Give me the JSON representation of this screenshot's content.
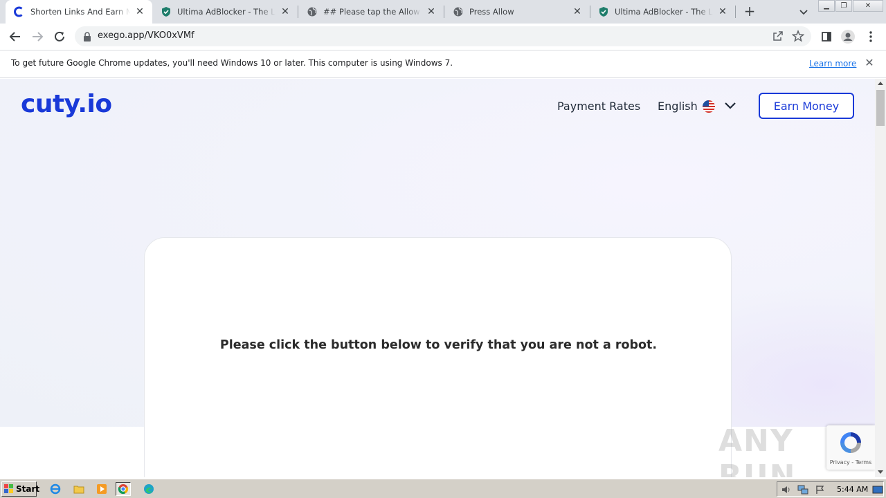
{
  "browser": {
    "tabs": [
      {
        "title": "Shorten Links And Earn Money",
        "favicon": "cuty-icon",
        "active": true
      },
      {
        "title": "Ultima AdBlocker - The Life with",
        "favicon": "shield-icon",
        "active": false
      },
      {
        "title": "## Please tap the Allow button",
        "favicon": "globe-icon",
        "active": false
      },
      {
        "title": "Press Allow",
        "favicon": "globe-icon",
        "active": false
      },
      {
        "title": "Ultima AdBlocker - The Life with",
        "favicon": "shield-icon",
        "active": false
      }
    ],
    "url": "exego.app/VKO0xVMf"
  },
  "infobar": {
    "message": "To get future Google Chrome updates, you'll need Windows 10 or later. This computer is using Windows 7.",
    "link": "Learn more"
  },
  "site": {
    "logo": "cuty.io",
    "nav": {
      "payment_rates": "Payment Rates",
      "language": "English",
      "earn_money": "Earn Money"
    },
    "card": {
      "verify_text": "Please click the button below to verify that you are not a robot."
    },
    "recaptcha_terms": "Privacy - Terms",
    "watermark": "ANY RUN"
  },
  "taskbar": {
    "start_label": "Start",
    "clock": "5:44 AM"
  },
  "colors": {
    "brand": "#1939d8",
    "hero_bg": "#eef1f8",
    "taskbar": "#d4d0c8"
  }
}
